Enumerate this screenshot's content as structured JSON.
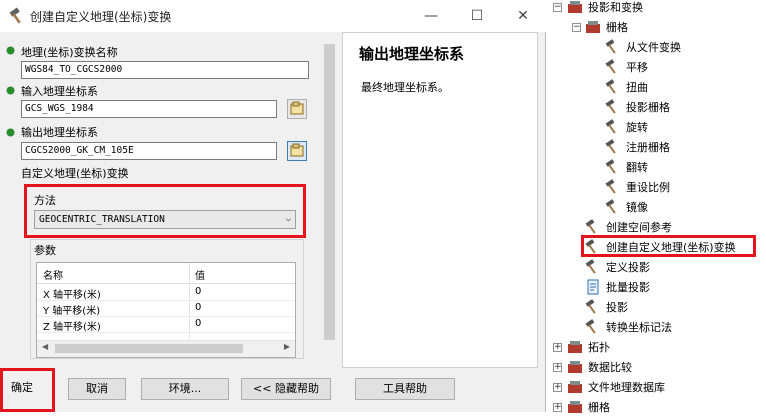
{
  "window": {
    "title": "创建自定义地理(坐标)变换",
    "controls": {
      "minimize": "—",
      "maximize": "☐",
      "close": "✕"
    }
  },
  "form": {
    "name_label": "地理(坐标)变换名称",
    "name_value": "WGS84_TO_CGCS2000",
    "input_label": "输入地理坐标系",
    "input_value": "GCS_WGS_1984",
    "output_label": "输出地理坐标系",
    "output_value": "CGCS2000_GK_CM_105E",
    "custom_label": "自定义地理(坐标)变换",
    "method_label": "方法",
    "method_value": "GEOCENTRIC_TRANSLATION",
    "params_label": "参数",
    "params_table": {
      "headers": [
        "名称",
        "值"
      ],
      "rows": [
        {
          "name": "X 轴平移(米)",
          "value": "0"
        },
        {
          "name": "Y 轴平移(米)",
          "value": "0"
        },
        {
          "name": "Z 轴平移(米)",
          "value": "0"
        }
      ]
    }
  },
  "help": {
    "title": "输出地理坐标系",
    "text": "最终地理坐标系。"
  },
  "buttons": {
    "ok": "确定",
    "cancel": "取消",
    "env": "环境...",
    "hide_help": "<< 隐藏帮助",
    "tool_help": "工具帮助"
  },
  "tree": {
    "projections_and_transformations": "投影和变换",
    "raster_group": "栅格",
    "raster_tools": [
      "从文件变换",
      "平移",
      "扭曲",
      "投影栅格",
      "旋转",
      "注册栅格",
      "翻转",
      "重设比例",
      "镜像"
    ],
    "tools": [
      "创建空间参考",
      "创建自定义地理(坐标)变换",
      "定义投影",
      "批量投影",
      "投影",
      "转换坐标记法"
    ],
    "toolsets": [
      "拓扑",
      "数据比较",
      "文件地理数据库",
      "栅格"
    ]
  },
  "colors": {
    "highlight": "#e3141d",
    "toolbox_red": "#c0392b"
  }
}
